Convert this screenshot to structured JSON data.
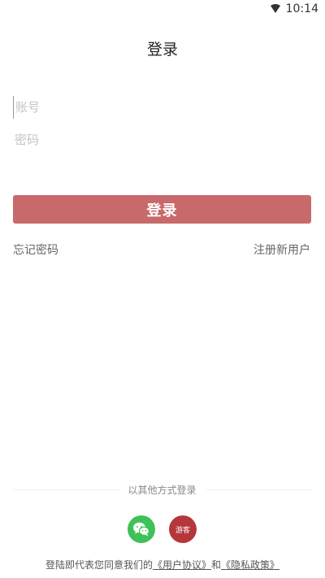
{
  "status_bar": {
    "time": "10:14"
  },
  "page": {
    "title": "登录"
  },
  "form": {
    "account_placeholder": "账号",
    "password_placeholder": "密码",
    "login_button": "登录"
  },
  "links": {
    "forgot_password": "忘记密码",
    "register": "注册新用户"
  },
  "other_login": {
    "label": "以其他方式登录",
    "guest_label": "游客"
  },
  "agreement": {
    "prefix": "登陆即代表您同意我们的",
    "user_agreement": "《用户协议》",
    "conjunction": "和",
    "privacy_policy": "《隐私政策》"
  },
  "colors": {
    "login_button": "#c8696b",
    "wechat": "#3dc158",
    "guest": "#b5373b"
  },
  "icons": {
    "wifi": "wifi-icon",
    "wechat": "wechat-icon"
  }
}
